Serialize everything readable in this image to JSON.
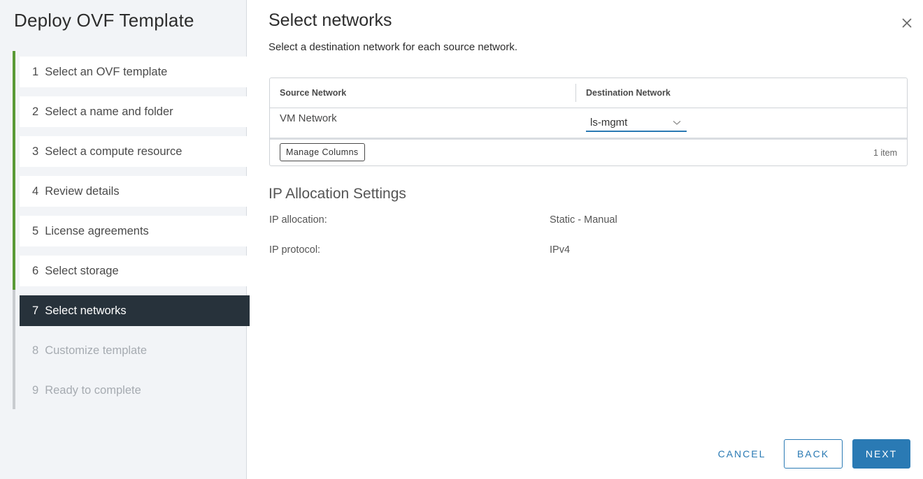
{
  "sidebar": {
    "title": "Deploy OVF Template",
    "steps": [
      {
        "num": "1",
        "label": "Select an OVF template",
        "state": "completed"
      },
      {
        "num": "2",
        "label": "Select a name and folder",
        "state": "completed"
      },
      {
        "num": "3",
        "label": "Select a compute resource",
        "state": "completed"
      },
      {
        "num": "4",
        "label": "Review details",
        "state": "completed"
      },
      {
        "num": "5",
        "label": "License agreements",
        "state": "completed"
      },
      {
        "num": "6",
        "label": "Select storage",
        "state": "completed"
      },
      {
        "num": "7",
        "label": "Select networks",
        "state": "active"
      },
      {
        "num": "8",
        "label": "Customize template",
        "state": "future"
      },
      {
        "num": "9",
        "label": "Ready to complete",
        "state": "future"
      }
    ]
  },
  "main": {
    "title": "Select networks",
    "subtitle": "Select a destination network for each source network.",
    "grid": {
      "columns": [
        "Source Network",
        "Destination Network"
      ],
      "rows": [
        {
          "source": "VM Network",
          "destination": "ls-mgmt"
        }
      ],
      "manage_columns_label": "Manage Columns",
      "item_count": "1 item"
    },
    "ip_section": {
      "title": "IP Allocation Settings",
      "fields": [
        {
          "label": "IP allocation:",
          "value": "Static - Manual"
        },
        {
          "label": "IP protocol:",
          "value": "IPv4"
        }
      ]
    }
  },
  "footer": {
    "cancel_label": "CANCEL",
    "back_label": "BACK",
    "next_label": "NEXT"
  },
  "colors": {
    "completed_track": "#5a9a36",
    "active_step_bg": "#27323b",
    "primary": "#2a7ab4"
  },
  "icons": {
    "close": "close-icon",
    "dropdown": "chevron-down-icon"
  }
}
